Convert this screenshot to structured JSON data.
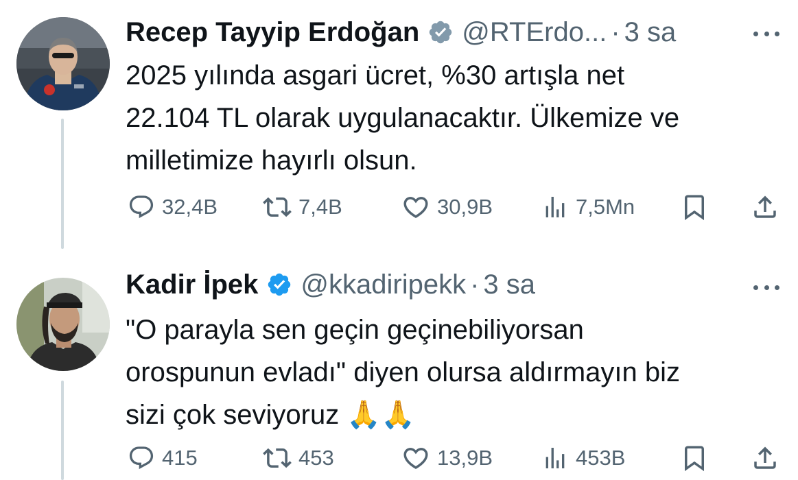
{
  "tweets": [
    {
      "display_name": "Recep Tayyip Erdoğan",
      "handle": "@RTErdo...",
      "separator": "·",
      "time": "3 sa",
      "text_lines": [
        "2025 yılında asgari ücret, %30 artışla net",
        "22.104 TL olarak uygulanacaktır. Ülkemize ve",
        "milletimize hayırlı olsun."
      ],
      "replies": "32,4B",
      "retweets": "7,4B",
      "likes": "30,9B",
      "views": "7,5Mn",
      "verified_badge": "gray"
    },
    {
      "display_name": "Kadir İpek",
      "handle": "@kkadiripekk",
      "separator": "·",
      "time": "3 sa",
      "text_lines": [
        "\"O parayla sen geçin geçinebiliyorsan",
        "orospunun evladı\" diyen olursa aldırmayın biz",
        "sizi çok seviyoruz 🙏🙏"
      ],
      "replies": "415",
      "retweets": "453",
      "likes": "13,9B",
      "views": "453B",
      "verified_badge": "blue"
    }
  ],
  "icons": [
    "reply-icon",
    "retweet-icon",
    "like-icon",
    "views-icon",
    "bookmark-icon",
    "share-icon",
    "more-icon",
    "verified-icon"
  ],
  "colors": {
    "text": "#0f1419",
    "secondary": "#536471",
    "verified_gray": "#829aab",
    "verified_blue": "#1d9bf0",
    "thread_line": "#cfd9de"
  }
}
